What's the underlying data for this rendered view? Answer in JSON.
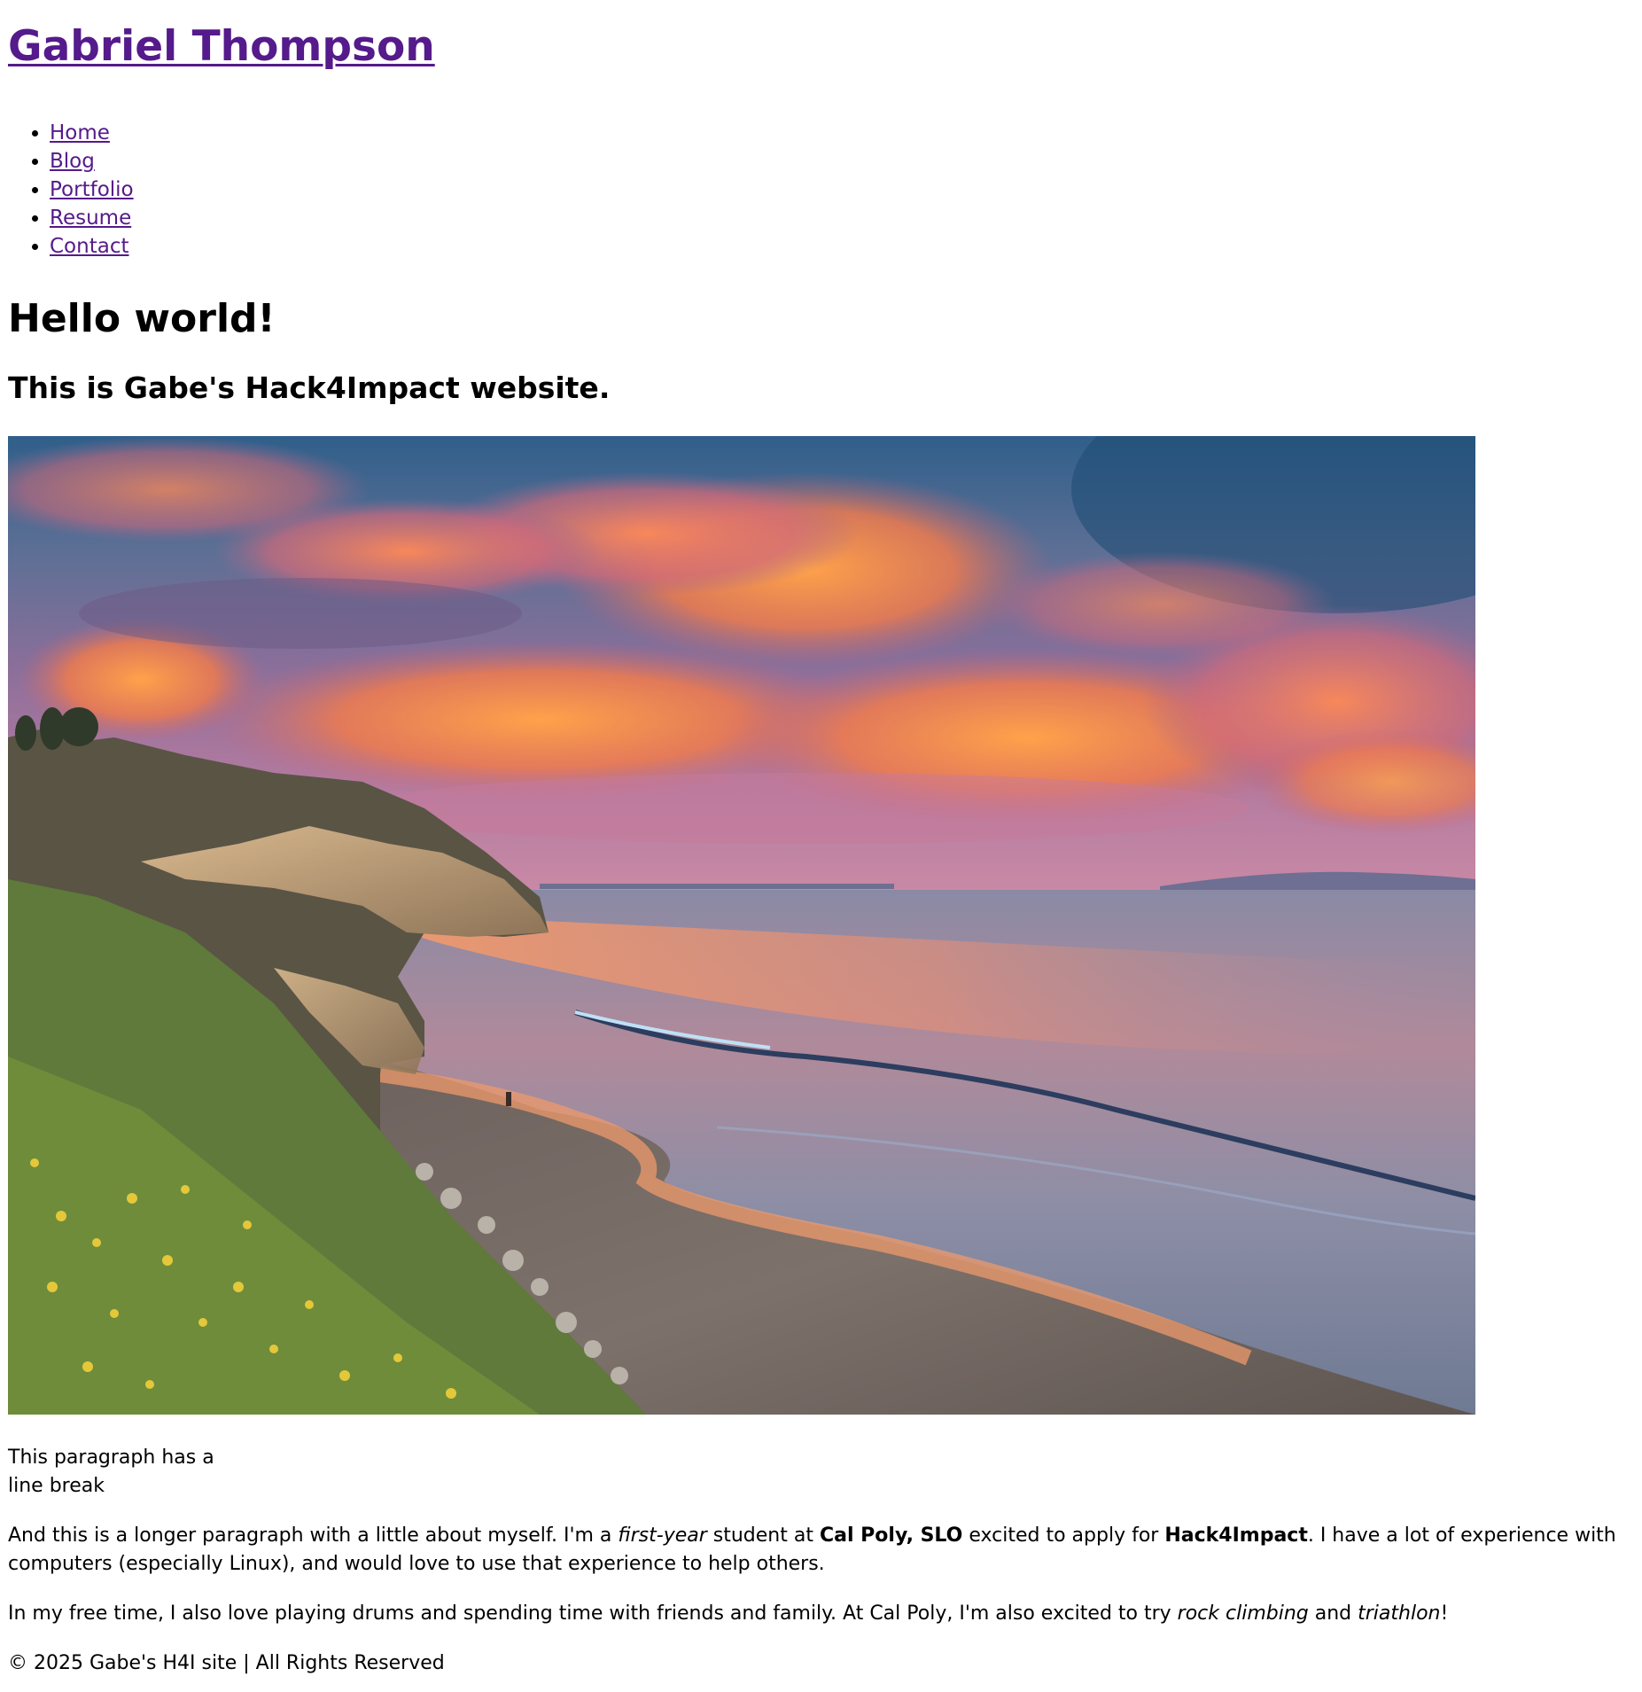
{
  "site": {
    "title": "Gabriel Thompson"
  },
  "nav": {
    "items": [
      {
        "label": "Home"
      },
      {
        "label": "Blog"
      },
      {
        "label": "Portfolio"
      },
      {
        "label": "Resume"
      },
      {
        "label": "Contact"
      }
    ]
  },
  "main": {
    "heading": "Hello world!",
    "subheading": "This is Gabe's Hack4Impact website.",
    "line_break_paragraph": {
      "line1": "This paragraph has a",
      "line2": "line break"
    },
    "about": {
      "part1": "And this is a longer paragraph with a little about myself. I'm a ",
      "italic1": "first-year",
      "part2": " student at ",
      "bold1": "Cal Poly, SLO",
      "part3": " excited to apply for ",
      "bold2": "Hack4Impact",
      "part4": ". I have a lot of experience with computers (especially Linux), and would love to use that experience to help others."
    },
    "free_time": {
      "part1": "In my free time, I also love playing drums and spending time with friends and family. At Cal Poly, I'm also excited to try ",
      "italic1": "rock climbing",
      "part2": " and ",
      "italic2": "triathlon",
      "part3": "!"
    }
  },
  "footer": {
    "text": "© 2025 Gabe's H4I site | All Rights Reserved"
  },
  "colors": {
    "link": "#551a8b",
    "text": "#000000",
    "background": "#ffffff"
  }
}
